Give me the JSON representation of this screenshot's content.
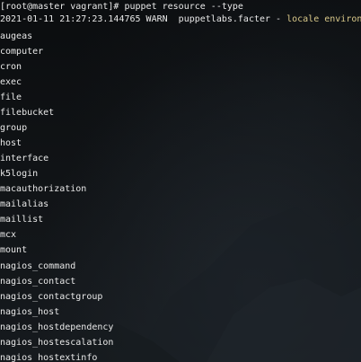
{
  "terminal": {
    "prompt_line": "[root@master vagrant]# puppet resource --type",
    "log_prefix": "2021-01-11 21:27:23.144765 WARN  puppetlabs.facter - ",
    "log_message": "locale environ",
    "resource_types": [
      "augeas",
      "computer",
      "cron",
      "exec",
      "file",
      "filebucket",
      "group",
      "host",
      "interface",
      "k5login",
      "macauthorization",
      "mailalias",
      "maillist",
      "mcx",
      "mount",
      "nagios_command",
      "nagios_contact",
      "nagios_contactgroup",
      "nagios_host",
      "nagios_hostdependency",
      "nagios_hostescalation",
      "nagios_hostextinfo"
    ]
  }
}
